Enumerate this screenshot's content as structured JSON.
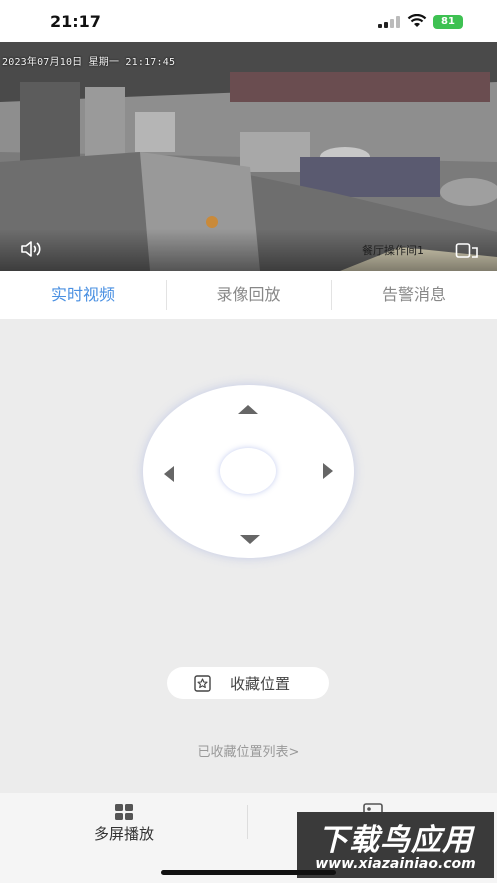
{
  "status_bar": {
    "time": "21:17",
    "battery": "81"
  },
  "video": {
    "osd_text": "2023年07月10日 星期一 21:17:45",
    "camera_name": "餐厅操作间1"
  },
  "tabs": [
    {
      "label": "实时视频",
      "active": true
    },
    {
      "label": "录像回放",
      "active": false
    },
    {
      "label": "告警消息",
      "active": false
    }
  ],
  "ptz": {
    "favorite_button": "收藏位置",
    "favorites_list_link": "已收藏位置列表>"
  },
  "bottom_bar": [
    {
      "label": "多屏播放",
      "icon": "grid-icon"
    },
    {
      "label": "",
      "icon": "image-icon"
    }
  ],
  "watermark": {
    "title": "下载鸟应用",
    "url": "www.xiazainiao.com"
  },
  "colors": {
    "accent": "#4a90e2",
    "battery": "#3ec152",
    "background": "#ececec"
  }
}
